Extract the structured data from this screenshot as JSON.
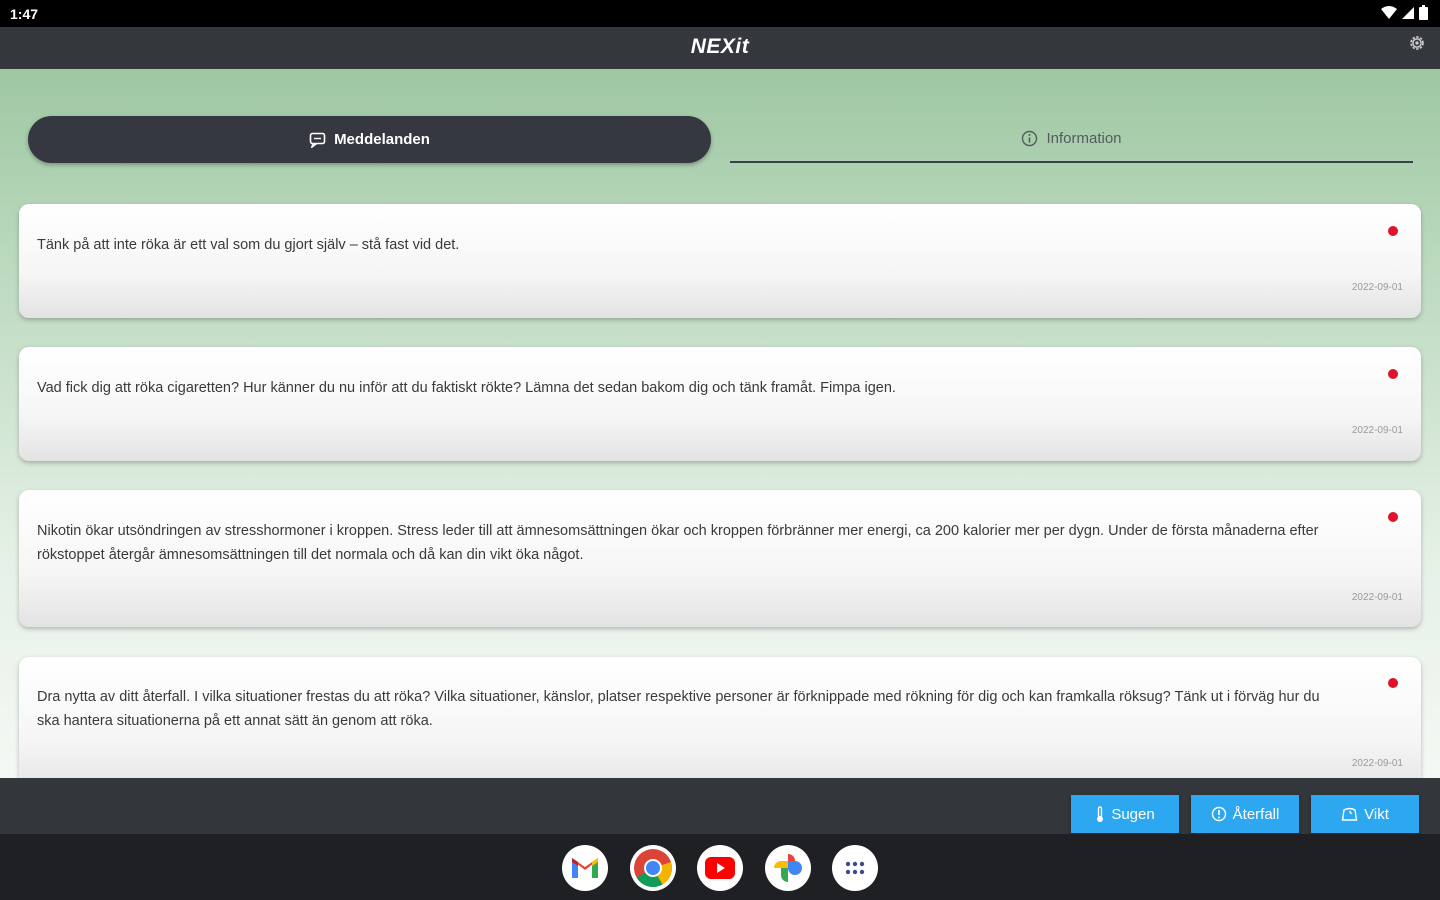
{
  "status": {
    "time": "1:47"
  },
  "app_bar": {
    "title": "NEXit"
  },
  "tabs": [
    {
      "label": "Meddelanden",
      "icon": "message-icon",
      "active": true
    },
    {
      "label": "Information",
      "icon": "info-icon",
      "active": false
    }
  ],
  "messages": [
    {
      "text": "Tänk på att inte röka är ett val som du gjort själv – stå fast vid det.",
      "date": "2022-09-01",
      "unread": true
    },
    {
      "text": "Vad fick dig att röka cigaretten? Hur känner du nu inför att du faktiskt rökte? Lämna det sedan bakom dig och tänk framåt. Fimpa igen.",
      "date": "2022-09-01",
      "unread": true
    },
    {
      "text": "Nikotin ökar utsöndringen av stresshormoner i kroppen. Stress leder till att ämnesomsättningen ökar och kroppen förbränner mer energi, ca 200 kalorier mer per dygn. Under de första månaderna efter rökstoppet återgår ämnesomsättningen till det normala och då kan din vikt öka något.",
      "date": "2022-09-01",
      "unread": true
    },
    {
      "text": "Dra nytta av ditt återfall. I vilka situationer frestas du att röka? Vilka situationer, känslor, platser respektive personer är förknippade med rökning för dig och kan framkalla röksug? Tänk ut i förväg hur du ska hantera situationerna på ett annat sätt än genom att röka.",
      "date": "2022-09-01",
      "unread": true
    }
  ],
  "bottom_actions": [
    {
      "label": "Sugen",
      "icon": "thermometer-icon"
    },
    {
      "label": "Återfall",
      "icon": "alert-icon"
    },
    {
      "label": "Vikt",
      "icon": "scale-icon"
    }
  ],
  "dock": [
    {
      "name": "gmail",
      "icon": "gmail-icon"
    },
    {
      "name": "chrome",
      "icon": "chrome-icon"
    },
    {
      "name": "youtube",
      "icon": "youtube-icon"
    },
    {
      "name": "photos",
      "icon": "photos-icon"
    },
    {
      "name": "app-drawer",
      "icon": "app-drawer-icon"
    }
  ],
  "colors": {
    "accent": "#2da7f0",
    "unread_dot": "#e0132a",
    "tab_active_bg": "#353840",
    "app_bar_bg": "#34373c"
  }
}
